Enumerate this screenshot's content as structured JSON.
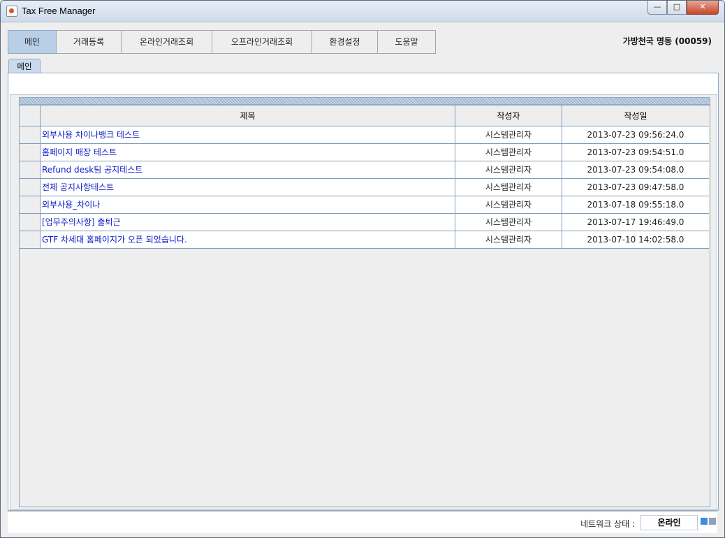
{
  "window": {
    "title": "Tax Free Manager",
    "controls": [
      "minimize",
      "maximize",
      "close"
    ]
  },
  "menu": {
    "tabs": [
      {
        "label": "메인",
        "active": true
      },
      {
        "label": "거래등록",
        "active": false
      },
      {
        "label": "온라인거래조회",
        "active": false
      },
      {
        "label": "오프라인거래조회",
        "active": false
      },
      {
        "label": "환경설정",
        "active": false
      },
      {
        "label": "도움말",
        "active": false
      }
    ]
  },
  "user": {
    "info": "가방천국 명동 (00059)"
  },
  "subtab": {
    "label": "메인"
  },
  "notices": {
    "columns": [
      "제목",
      "작성자",
      "작성일"
    ],
    "rows": [
      {
        "title": "외부사용 차이나뱅크 테스트",
        "author": "시스템관리자",
        "date": "2013-07-23 09:56:24.0"
      },
      {
        "title": "홈페이지 매장 테스트",
        "author": "시스템관리자",
        "date": "2013-07-23 09:54:51.0"
      },
      {
        "title": "Refund desk팀 공지테스트",
        "author": "시스템관리자",
        "date": "2013-07-23 09:54:08.0"
      },
      {
        "title": "전체 공지사항테스트",
        "author": "시스템관리자",
        "date": "2013-07-23 09:47:58.0"
      },
      {
        "title": "외부사용_차이나",
        "author": "시스템관리자",
        "date": "2013-07-18 09:55:18.0"
      },
      {
        "title": "[업무주의사항] 출퇴근",
        "author": "시스템관리자",
        "date": "2013-07-17 19:46:49.0"
      },
      {
        "title": "GTF 차세대 홈페이지가 오픈 되었습니다.",
        "author": "시스템관리자",
        "date": "2013-07-10 14:02:58.0"
      }
    ]
  },
  "status": {
    "network_label": "네트워크 상태 :",
    "network_value": "온라인"
  },
  "colors": {
    "link": "#1020c8",
    "active_tab": "#b8cfe5",
    "border_accent": "#8ea9c5",
    "online_indicator": "#3a8ee6"
  }
}
